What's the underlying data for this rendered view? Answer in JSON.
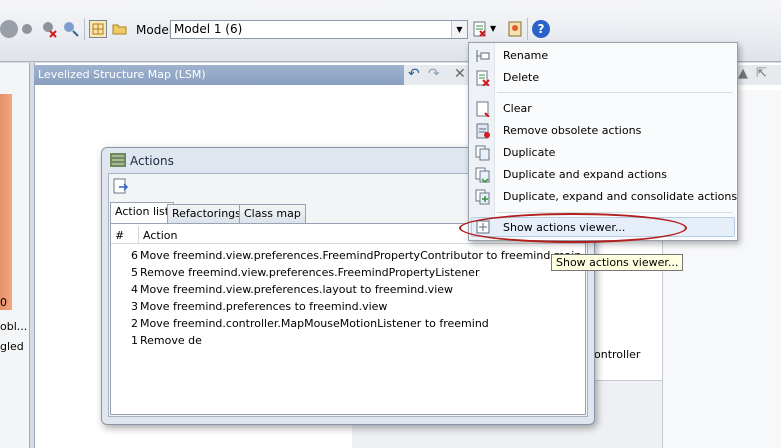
{
  "toolbar": {
    "model_label": "Model:",
    "model_value": "Model 1 (6)"
  },
  "lsm": {
    "title": "Levelized Structure Map (LSM)"
  },
  "left_panel": {
    "text1": "0",
    "text2": "obl...",
    "text3": "gled"
  },
  "right_pane": {
    "text1": "ontroller"
  },
  "actions_window": {
    "title": "Actions",
    "tabs": [
      "Action list",
      "Refactorings",
      "Class map"
    ],
    "columns": [
      "#",
      "Action"
    ],
    "rows": [
      {
        "num": "6",
        "text": "Move freemind.view.preferences.FreemindPropertyContributor to freemind.main"
      },
      {
        "num": "5",
        "text": "Remove freemind.view.preferences.FreemindPropertyListener"
      },
      {
        "num": "4",
        "text": "Move freemind.view.preferences.layout to freemind.view"
      },
      {
        "num": "3",
        "text": "Move freemind.preferences to freemind.view"
      },
      {
        "num": "2",
        "text": "Move freemind.controller.MapMouseMotionListener to freemind"
      },
      {
        "num": "1",
        "text": "Remove de"
      }
    ]
  },
  "menu": {
    "items": [
      {
        "label": "Rename",
        "icon": "rename-icon"
      },
      {
        "label": "Delete",
        "icon": "delete-icon"
      },
      {
        "label": "Clear",
        "icon": "clear-icon"
      },
      {
        "label": "Remove obsolete actions",
        "icon": "remove-obsolete-icon"
      },
      {
        "label": "Duplicate",
        "icon": "duplicate-icon"
      },
      {
        "label": "Duplicate and expand actions",
        "icon": "duplicate-expand-icon"
      },
      {
        "label": "Duplicate, expand and consolidate actions",
        "icon": "duplicate-consolidate-icon"
      },
      {
        "label": "Show actions viewer...",
        "icon": "show-viewer-icon"
      }
    ]
  },
  "tooltip": {
    "text": "Show actions viewer..."
  },
  "colors": {
    "annotation": "#b21f1f",
    "lsm_header": "#9fb3cf"
  }
}
